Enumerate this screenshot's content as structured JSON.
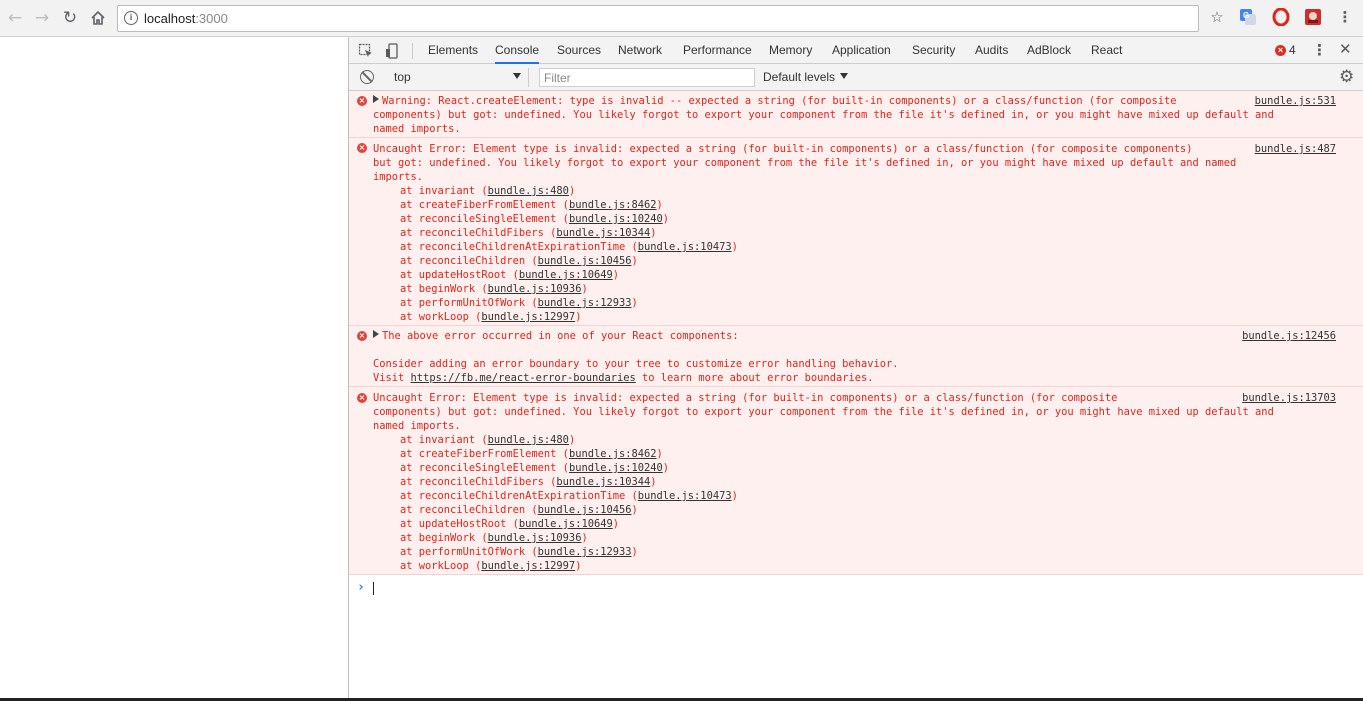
{
  "browser": {
    "url_host": "localhost",
    "url_port": ":3000",
    "back_icon": "arrow-left-icon",
    "forward_icon": "arrow-right-icon",
    "reload_icon": "reload-icon",
    "home_icon": "home-icon",
    "info_icon": "info-icon",
    "bookmark_icon": "star-icon",
    "translate_icon": "google-translate-icon",
    "opera_icon": "opera-icon",
    "extension_icon": "extension-icon",
    "menu_icon": "kebab-menu-icon"
  },
  "devtools": {
    "tabs": [
      {
        "label": "Elements",
        "active": false
      },
      {
        "label": "Console",
        "active": true
      },
      {
        "label": "Sources",
        "active": false
      },
      {
        "label": "Network",
        "active": false
      },
      {
        "label": "Performance",
        "active": false
      },
      {
        "label": "Memory",
        "active": false
      },
      {
        "label": "Application",
        "active": false
      },
      {
        "label": "Security",
        "active": false
      },
      {
        "label": "Audits",
        "active": false
      },
      {
        "label": "AdBlock",
        "active": false
      },
      {
        "label": "React",
        "active": false
      }
    ],
    "error_count": "4",
    "toolbar": {
      "context": "top",
      "filter_placeholder": "Filter",
      "levels": "Default levels"
    },
    "accent_color": "#1a73e8",
    "error_color": "#e0261a",
    "error_bg": "#fff0f0"
  },
  "console": {
    "messages": [
      {
        "text": "Warning: React.createElement: type is invalid -- expected a string (for built-in components) or a class/function (for composite\ncomponents) but got: undefined. You likely forgot to export your component from the file it's defined in, or you might have mixed up default and\nnamed imports.",
        "source": "bundle.js:531"
      },
      {
        "text": "Uncaught Error: Element type is invalid: expected a string (for built-in components) or a class/function (for composite components)\nbut got: undefined. You likely forgot to export your component from the file it's defined in, or you might have mixed up default and named\nimports.",
        "source": "bundle.js:487",
        "stack": [
          {
            "fn": "invariant",
            "loc": "bundle.js:480"
          },
          {
            "fn": "createFiberFromElement",
            "loc": "bundle.js:8462"
          },
          {
            "fn": "reconcileSingleElement",
            "loc": "bundle.js:10240"
          },
          {
            "fn": "reconcileChildFibers",
            "loc": "bundle.js:10344"
          },
          {
            "fn": "reconcileChildrenAtExpirationTime",
            "loc": "bundle.js:10473"
          },
          {
            "fn": "reconcileChildren",
            "loc": "bundle.js:10456"
          },
          {
            "fn": "updateHostRoot",
            "loc": "bundle.js:10649"
          },
          {
            "fn": "beginWork",
            "loc": "bundle.js:10936"
          },
          {
            "fn": "performUnitOfWork",
            "loc": "bundle.js:12933"
          },
          {
            "fn": "workLoop",
            "loc": "bundle.js:12997"
          }
        ]
      },
      {
        "text": "The above error occurred in one of your React components:",
        "line2": "Consider adding an error boundary to your tree to customize error handling behavior.",
        "line3_prefix": "Visit ",
        "line3_link": "https://fb.me/react-error-boundaries",
        "line3_suffix": " to learn more about error boundaries.",
        "source": "bundle.js:12456"
      },
      {
        "text": "Uncaught Error: Element type is invalid: expected a string (for built-in components) or a class/function (for composite\ncomponents) but got: undefined. You likely forgot to export your component from the file it's defined in, or you might have mixed up default and\nnamed imports.",
        "source": "bundle.js:13703",
        "stack": [
          {
            "fn": "invariant",
            "loc": "bundle.js:480"
          },
          {
            "fn": "createFiberFromElement",
            "loc": "bundle.js:8462"
          },
          {
            "fn": "reconcileSingleElement",
            "loc": "bundle.js:10240"
          },
          {
            "fn": "reconcileChildFibers",
            "loc": "bundle.js:10344"
          },
          {
            "fn": "reconcileChildrenAtExpirationTime",
            "loc": "bundle.js:10473"
          },
          {
            "fn": "reconcileChildren",
            "loc": "bundle.js:10456"
          },
          {
            "fn": "updateHostRoot",
            "loc": "bundle.js:10649"
          },
          {
            "fn": "beginWork",
            "loc": "bundle.js:10936"
          },
          {
            "fn": "performUnitOfWork",
            "loc": "bundle.js:12933"
          },
          {
            "fn": "workLoop",
            "loc": "bundle.js:12997"
          }
        ]
      }
    ],
    "prompt_symbol": "›"
  }
}
